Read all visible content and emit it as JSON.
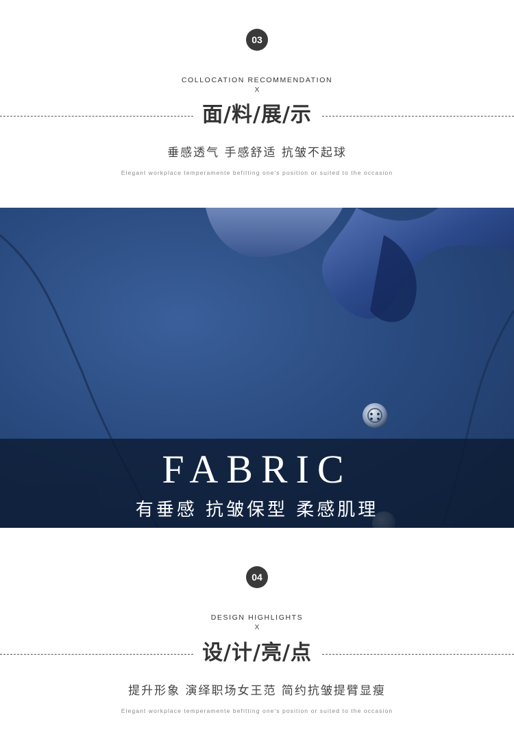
{
  "section_fabric": {
    "number": "03",
    "en_heading": "COLLOCATION RECOMMENDATION",
    "x_mark": "X",
    "title": "面/料/展/示",
    "subtitle": "垂感透气  手感舒适  抗皱不起球",
    "tagline": "Elegant workplace temperamente befitting one's position or suited to the occasion"
  },
  "banner": {
    "word": "FABRIC",
    "subtitle": "有垂感 抗皱保型 柔感肌理"
  },
  "section_design": {
    "number": "04",
    "en_heading": "DESIGN HIGHLIGHTS",
    "x_mark": "X",
    "title": "设/计/亮/点",
    "subtitle": "提升形象  演绎职场女王范  简约抗皱提臂显瘦",
    "tagline": "Elegant workplace temperamente befitting one's position or suited to the occasion"
  },
  "colors": {
    "fabric_blue": "#2a4b80",
    "band_dark": "#0c1a30",
    "badge": "#3a3a3a"
  }
}
